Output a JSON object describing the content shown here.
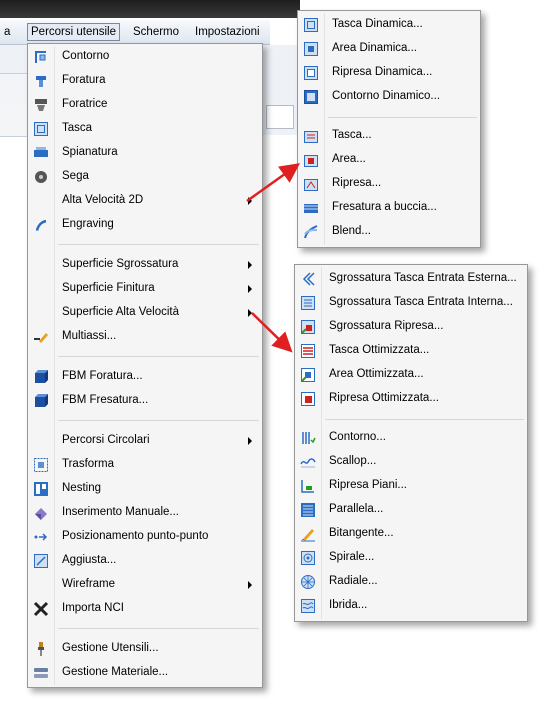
{
  "menubar": {
    "prev_label": "a",
    "active_label": "Percorsi utensile",
    "schermo_label": "Schermo",
    "impostazioni_label": "Impostazioni"
  },
  "main_menu": {
    "contorno": "Contorno",
    "foratura": "Foratura",
    "foratrice": "Foratrice",
    "tasca": "Tasca",
    "spianatura": "Spianatura",
    "sega": "Sega",
    "alta_velocita_2d": "Alta Velocità 2D",
    "engraving": "Engraving",
    "superficie_sgrossatura": "Superficie Sgrossatura",
    "superficie_finitura": "Superficie Finitura",
    "superficie_alta_velocita": "Superficie Alta Velocità",
    "multiassi": "Multiassi...",
    "fbm_foratura": "FBM Foratura...",
    "fbm_fresatura": "FBM Fresatura...",
    "percorsi_circolari": "Percorsi Circolari",
    "trasforma": "Trasforma",
    "nesting": "Nesting",
    "inserimento_manuale": "Inserimento Manuale...",
    "posizionamento": "Posizionamento punto-punto",
    "aggiusta": "Aggiusta...",
    "wireframe": "Wireframe",
    "importa_nci": "Importa NCI",
    "gestione_utensili": "Gestione Utensili...",
    "gestione_materiale": "Gestione Materiale..."
  },
  "submenu_2d": {
    "tasca_dinamica": "Tasca Dinamica...",
    "area_dinamica": "Area Dinamica...",
    "ripresa_dinamica": "Ripresa Dinamica...",
    "contorno_dinamico": "Contorno Dinamico...",
    "tasca": "Tasca...",
    "area": "Area...",
    "ripresa": "Ripresa...",
    "fresatura_buccia": "Fresatura a buccia...",
    "blend": "Blend..."
  },
  "submenu_surface": {
    "sgross_esterna": "Sgrossatura Tasca Entrata Esterna...",
    "sgross_interna": "Sgrossatura Tasca Entrata Interna...",
    "sgross_ripresa": "Sgrossatura Ripresa...",
    "tasca_ottimizzata": "Tasca Ottimizzata...",
    "area_ottimizzata": "Area Ottimizzata...",
    "ripresa_ottimizzata": "Ripresa Ottimizzata...",
    "contorno": "Contorno...",
    "scallop": "Scallop...",
    "ripresa_piani": "Ripresa Piani...",
    "parallela": "Parallela...",
    "bitangente": "Bitangente...",
    "spirale": "Spirale...",
    "radiale": "Radiale...",
    "ibrida": "Ibrida..."
  },
  "colors": {
    "menu_bg": "#f5f5f5",
    "icon_blue": "#2b6cc4",
    "icon_red": "#d02020",
    "arrow_red": "#e02020"
  }
}
